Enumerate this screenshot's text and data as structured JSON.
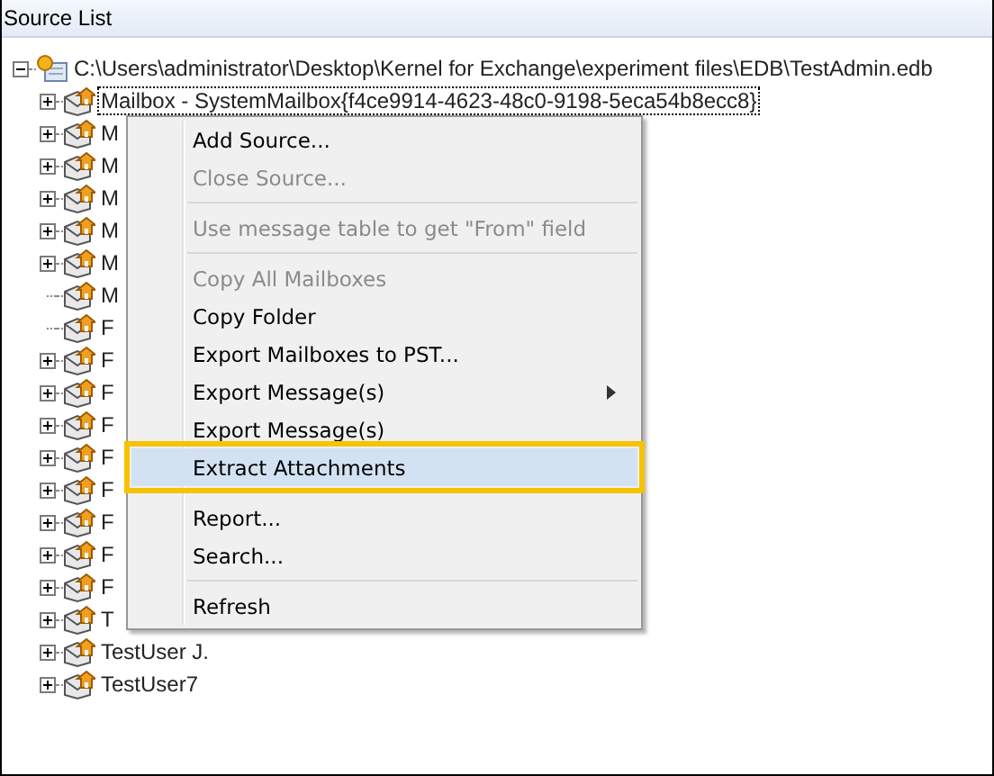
{
  "panel": {
    "title": "Source List"
  },
  "tree": {
    "label": "C:\\Users\\administrator\\Desktop\\Kernel for Exchange\\experiment files\\EDB\\TestAdmin.edb",
    "expanded": true,
    "children": [
      {
        "label": "Mailbox - SystemMailbox{f4ce9914-4623-48c0-9198-5eca54b8ecc8}",
        "expandable": true,
        "focused": true
      },
      {
        "label": "M",
        "expandable": true,
        "focused": false
      },
      {
        "label": "M",
        "expandable": true,
        "focused": false
      },
      {
        "label": "M",
        "expandable": true,
        "focused": false
      },
      {
        "label": "M",
        "expandable": true,
        "focused": false
      },
      {
        "label": "M",
        "expandable": true,
        "focused": false
      },
      {
        "label": "M",
        "expandable": false,
        "focused": false
      },
      {
        "label": "F",
        "expandable": false,
        "focused": false
      },
      {
        "label": "F",
        "expandable": true,
        "focused": false
      },
      {
        "label": "F",
        "expandable": true,
        "focused": false
      },
      {
        "label": "F",
        "expandable": true,
        "focused": false
      },
      {
        "label": "F",
        "expandable": true,
        "focused": false
      },
      {
        "label": "F",
        "expandable": true,
        "focused": false
      },
      {
        "label": "F",
        "expandable": true,
        "focused": false
      },
      {
        "label": "F",
        "expandable": true,
        "focused": false
      },
      {
        "label": "F",
        "expandable": true,
        "focused": false
      },
      {
        "label": "T",
        "expandable": true,
        "focused": false
      },
      {
        "label": "TestUser J.",
        "expandable": true,
        "focused": false
      },
      {
        "label": "TestUser7",
        "expandable": true,
        "focused": false
      }
    ]
  },
  "context_menu": [
    {
      "kind": "item",
      "label": "Add Source...",
      "disabled": false,
      "selected": false
    },
    {
      "kind": "item",
      "label": "Close Source...",
      "disabled": true,
      "selected": false
    },
    {
      "kind": "separator"
    },
    {
      "kind": "item",
      "label": "Use message table to get \"From\" field",
      "disabled": true,
      "selected": false
    },
    {
      "kind": "separator"
    },
    {
      "kind": "item",
      "label": "Copy All Mailboxes",
      "disabled": true,
      "selected": false
    },
    {
      "kind": "item",
      "label": "Copy Folder",
      "disabled": false,
      "selected": false
    },
    {
      "kind": "item",
      "label": "Export Mailboxes to PST...",
      "disabled": false,
      "selected": false
    },
    {
      "kind": "submenu",
      "label": "Export Message(s)",
      "disabled": false,
      "selected": false
    },
    {
      "kind": "item",
      "label": "Export Message(s)",
      "disabled": false,
      "selected": false
    },
    {
      "kind": "item",
      "label": "Extract Attachments",
      "disabled": false,
      "selected": true
    },
    {
      "kind": "separator"
    },
    {
      "kind": "item",
      "label": "Report...",
      "disabled": false,
      "selected": false
    },
    {
      "kind": "item",
      "label": "Search...",
      "disabled": false,
      "selected": false
    },
    {
      "kind": "separator"
    },
    {
      "kind": "item",
      "label": "Refresh",
      "disabled": false,
      "selected": false
    }
  ]
}
